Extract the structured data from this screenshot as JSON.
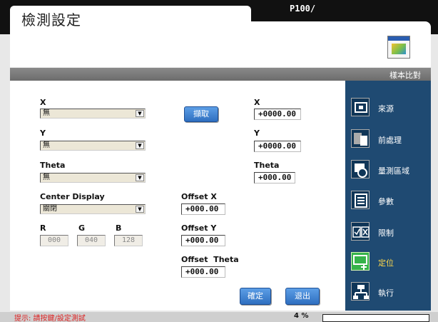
{
  "header": {
    "title": "檢測設定",
    "model": "P100/",
    "section": "樣本比對"
  },
  "form": {
    "x_label": "X",
    "x_value": "無",
    "y_label": "Y",
    "y_value": "無",
    "theta_label": "Theta",
    "theta_value": "無",
    "center_label": "Center Display",
    "center_value": "關閉",
    "r_label": "R",
    "g_label": "G",
    "b_label": "B",
    "r_value": "000",
    "g_value": "040",
    "b_value": "128",
    "capture_label": "擷取",
    "x_coord_label": "X",
    "x_coord_value": "+0000.00",
    "y_coord_label": "Y",
    "y_coord_value": "+0000.00",
    "theta_coord_label": "Theta",
    "theta_coord_value": "+000.00",
    "offset_x_label": "Offset X",
    "offset_x_value": "+000.00",
    "offset_y_label": "Offset Y",
    "offset_y_value": "+000.00",
    "offset_theta_label": "Offset  Theta",
    "offset_theta_value": "+000.00",
    "confirm_label": "確定",
    "exit_label": "退出"
  },
  "sidebar": {
    "items": [
      {
        "label": "來源",
        "icon": "source-icon"
      },
      {
        "label": "前處理",
        "icon": "preprocess-icon"
      },
      {
        "label": "量測區域",
        "icon": "measure-area-icon"
      },
      {
        "label": "參數",
        "icon": "parameter-icon"
      },
      {
        "label": "限制",
        "icon": "limit-icon"
      },
      {
        "label": "定位",
        "icon": "positioning-icon",
        "active": true
      },
      {
        "label": "執行",
        "icon": "execute-icon"
      }
    ]
  },
  "status": {
    "message": "提示: 請按鍵/設定測試",
    "percent": "4 %"
  },
  "colors": {
    "sidebar": "#1f4a72",
    "accent": "#2f6fc0",
    "active": "#35b34a"
  }
}
